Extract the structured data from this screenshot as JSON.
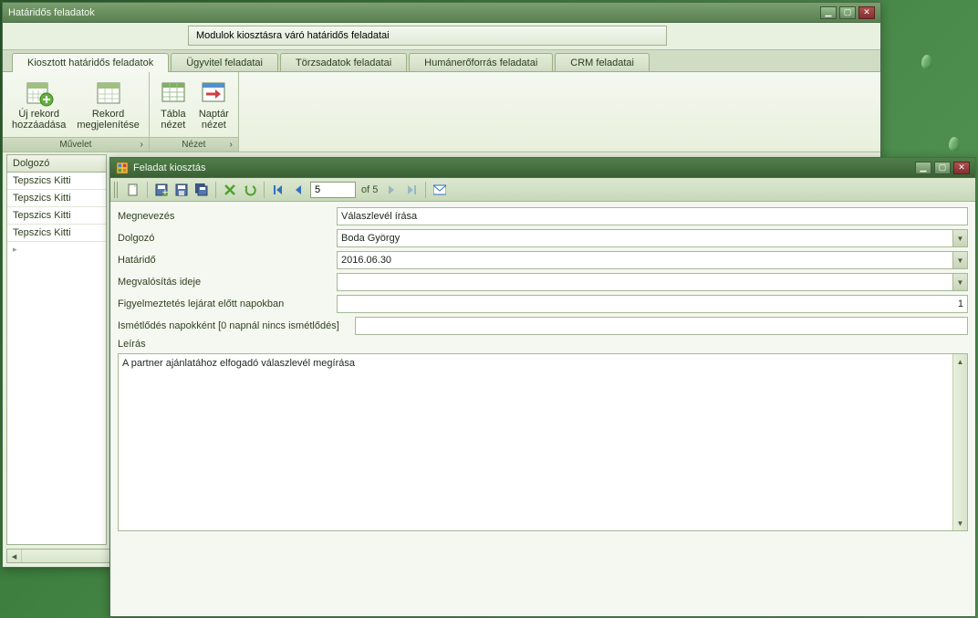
{
  "mainWindow": {
    "title": "Határidős feladatok",
    "breadcrumb": "Modulok kiosztásra váró határidős feladatai"
  },
  "tabs": [
    {
      "label": "Kiosztott határidős feladatok",
      "active": true
    },
    {
      "label": "Ügyvitel feladatai",
      "active": false
    },
    {
      "label": "Törzsadatok feladatai",
      "active": false
    },
    {
      "label": "Humánerőforrás feladatai",
      "active": false
    },
    {
      "label": "CRM feladatai",
      "active": false
    }
  ],
  "ribbon": {
    "groups": [
      {
        "label": "Művelet",
        "items": [
          {
            "name": "new-record",
            "label1": "Új rekord",
            "label2": "hozzáadása",
            "icon": "calendar-plus"
          },
          {
            "name": "show-record",
            "label1": "Rekord",
            "label2": "megjelenítése",
            "icon": "calendar-grid"
          }
        ]
      },
      {
        "label": "Nézet",
        "items": [
          {
            "name": "table-view",
            "label1": "Tábla",
            "label2": "nézet",
            "icon": "table"
          },
          {
            "name": "calendar-view",
            "label1": "Naptár",
            "label2": "nézet",
            "icon": "calendar-arrow"
          }
        ]
      }
    ]
  },
  "grid": {
    "header": "Dolgozó",
    "rows": [
      "Tepszics Kitti",
      "Tepszics Kitti",
      "Tepszics Kitti",
      "Tepszics Kitti"
    ]
  },
  "dialog": {
    "title": "Feladat kiosztás",
    "paging": {
      "current": "5",
      "of": "of 5"
    },
    "fields": {
      "megnevezes": {
        "label": "Megnevezés",
        "value": "Válaszlevél írása"
      },
      "dolgozo": {
        "label": "Dolgozó",
        "value": "Boda György"
      },
      "hatarido": {
        "label": "Határidő",
        "value": "2016.06.30"
      },
      "megvalositas": {
        "label": "Megvalósítás ideje",
        "value": ""
      },
      "figyelmeztetes": {
        "label": "Figyelmeztetés lejárat előtt napokban",
        "value": "1"
      },
      "ismetlodes": {
        "label": "Ismétlődés napokként [0 napnál nincs ismétlődés]",
        "value": ""
      },
      "leiras": {
        "label": "Leírás",
        "value": "A partner ajánlatához elfogadó válaszlevél megírása"
      }
    }
  }
}
